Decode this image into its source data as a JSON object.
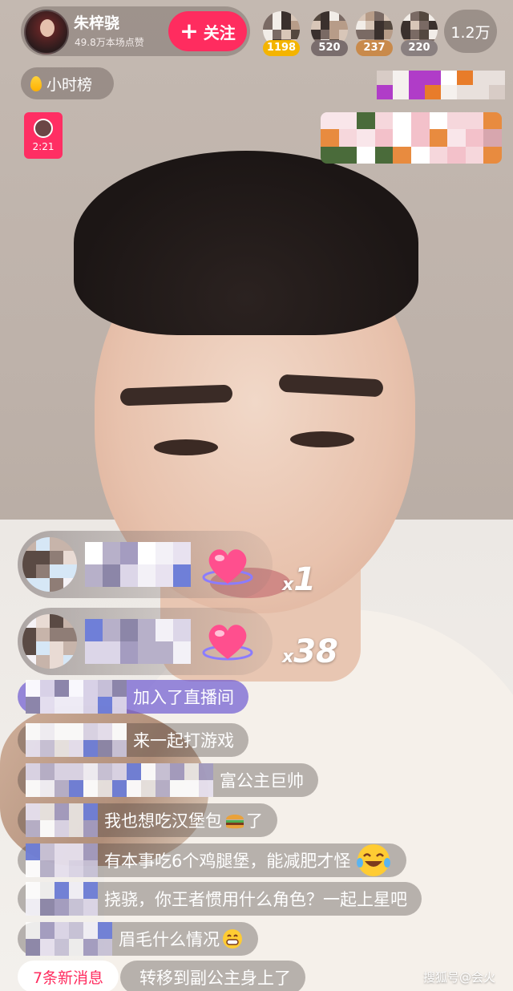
{
  "host": {
    "name": "朱梓骁",
    "likes": "49.8万本场点赞",
    "follow_label": "关注"
  },
  "top_viewers": [
    {
      "count": "1198",
      "badge_color": "#f4b400"
    },
    {
      "count": "520",
      "badge_color": "#7a6d6d"
    },
    {
      "count": "237",
      "badge_color": "#c98a4b"
    },
    {
      "count": "220",
      "badge_color": "#8a8080"
    }
  ],
  "online_count": "1.2万",
  "rank": {
    "label": "小时榜"
  },
  "red_packet": {
    "time": "2:21"
  },
  "gifts": [
    {
      "multiplier_x": "x",
      "multiplier": "1"
    },
    {
      "multiplier_x": "x",
      "multiplier": "38"
    }
  ],
  "chat": [
    {
      "type": "join",
      "text": "加入了直播间"
    },
    {
      "type": "comment",
      "text": "来一起打游戏"
    },
    {
      "type": "comment",
      "text": "富公主巨帅"
    },
    {
      "type": "comment",
      "text": "我也想吃汉堡包",
      "emoji": "hamburger-emoji",
      "tail": "了"
    },
    {
      "type": "comment",
      "text": "有本事吃6个鸡腿堡，能减肥才怪",
      "emoji": "laughing-tears-emoji"
    },
    {
      "type": "comment",
      "text": "挠骁，你王者惯用什么角色？一起上星吧"
    },
    {
      "type": "comment",
      "text": "眉毛什么情况",
      "emoji": "grinning-emoji"
    },
    {
      "type": "comment",
      "text": "转移到副公主身上了"
    }
  ],
  "new_messages": "7条新消息",
  "watermark": "搜狐号@会火",
  "colors": {
    "accent": "#ff2c5f",
    "join_bg": "#6e5ad2"
  }
}
